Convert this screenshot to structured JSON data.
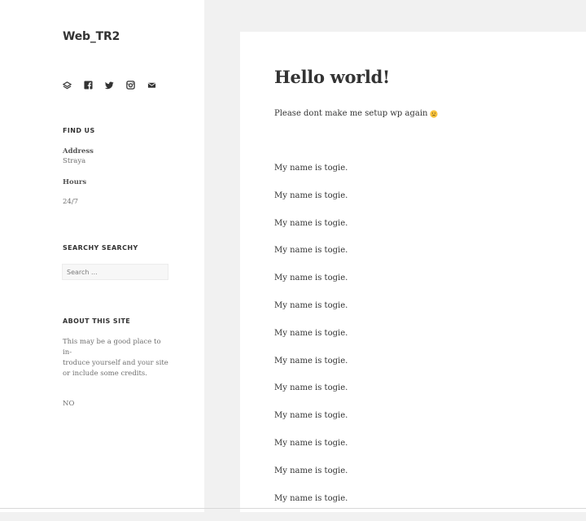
{
  "site": {
    "title": "Web_TR2"
  },
  "social_links": [
    {
      "icon": "codepen-icon",
      "name": "social-link-codepen"
    },
    {
      "icon": "facebook-icon",
      "name": "social-link-facebook"
    },
    {
      "icon": "twitter-icon",
      "name": "social-link-twitter"
    },
    {
      "icon": "instagram-icon",
      "name": "social-link-instagram"
    },
    {
      "icon": "email-icon",
      "name": "social-link-email"
    }
  ],
  "find_us": {
    "title": "FIND US",
    "address_label": "Address",
    "address_value": "Straya",
    "hours_label": "Hours",
    "hours_value": "24/7"
  },
  "search_widget": {
    "title": "SEARCHY SEARCHY",
    "placeholder": "Search ..."
  },
  "about": {
    "title": "ABOUT THIS SITE",
    "line1": "This may be a good place to in-",
    "line2": "troduce yourself and your site",
    "line3": "or include some credits.",
    "extra": "NO"
  },
  "post": {
    "title": "Hello world!",
    "intro": "Please dont make me setup wp again",
    "emoji": "slightly-frowning-face-emoji",
    "lines": [
      "My name is togie.",
      "My name is togie.",
      "My name is togie.",
      "My name is togie.",
      "My name is togie.",
      "My name is togie.",
      "My name is togie.",
      "My name is togie.",
      "My name is togie.",
      "My name is togie.",
      "My name is togie.",
      "My name is togie.",
      "My name is togie."
    ]
  },
  "colors": {
    "page_background": "#f1f1f1",
    "panel_background": "#ffffff",
    "text": "#333333",
    "muted_text": "#707070"
  }
}
